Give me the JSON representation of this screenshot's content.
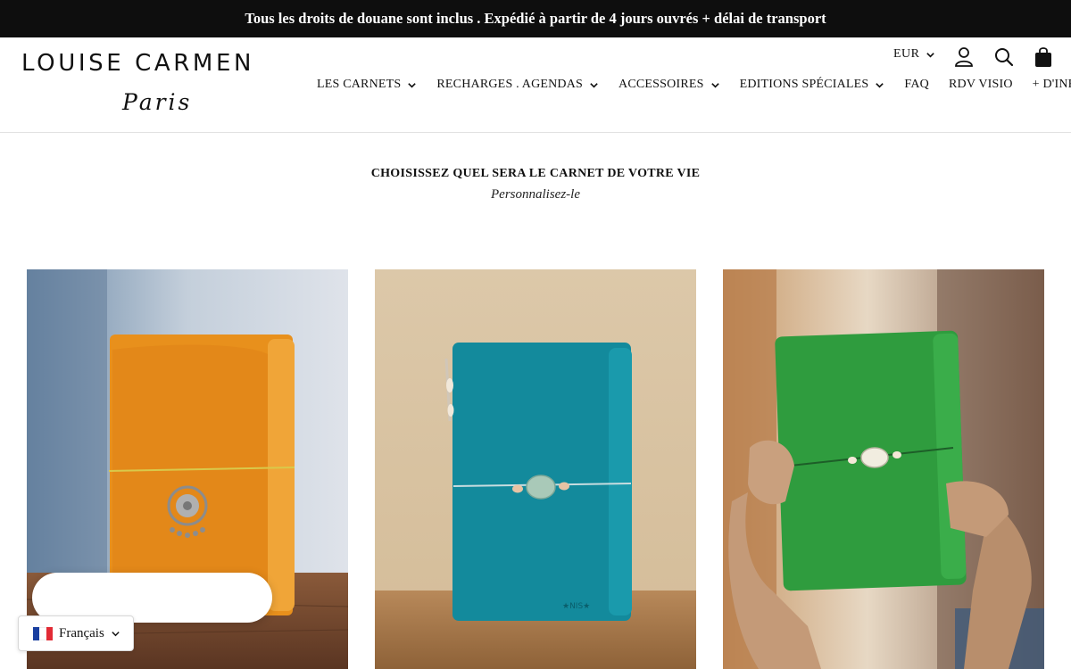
{
  "announcement": "Tous les droits de douane sont inclus . Expédié à partir de 4 jours ouvrés + délai de transport",
  "brand": {
    "name": "LOUISE CARMEN",
    "city": "Paris"
  },
  "header": {
    "currency": "EUR",
    "icons": [
      "account-icon",
      "search-icon",
      "cart-icon"
    ]
  },
  "nav": [
    {
      "label": "LES CARNETS",
      "has_dropdown": true
    },
    {
      "label": "RECHARGES . AGENDAS",
      "has_dropdown": true
    },
    {
      "label": "ACCESSOIRES",
      "has_dropdown": true
    },
    {
      "label": "EDITIONS SPÉCIALES",
      "has_dropdown": true
    },
    {
      "label": "FAQ",
      "has_dropdown": false
    },
    {
      "label": "RDV VISIO",
      "has_dropdown": false
    },
    {
      "label": "+ D'INFOS",
      "has_dropdown": true
    }
  ],
  "section": {
    "title": "CHOISISSEZ QUEL SERA LE CARNET DE VOTRE VIE",
    "subtitle": "Personnalisez-le"
  },
  "products": [
    {
      "image": "orange-leather-notebook-photo",
      "color": "#e8901c"
    },
    {
      "image": "teal-leather-notebook-photo",
      "color": "#138a9c",
      "engraving": "★NIS★"
    },
    {
      "image": "green-leather-notebook-photo",
      "color": "#2f9c3e"
    }
  ],
  "language": {
    "label": "Français",
    "flag": "fr-flag-icon"
  },
  "colors": {
    "announcement_bg": "#0e0e0e",
    "text": "#111111"
  }
}
